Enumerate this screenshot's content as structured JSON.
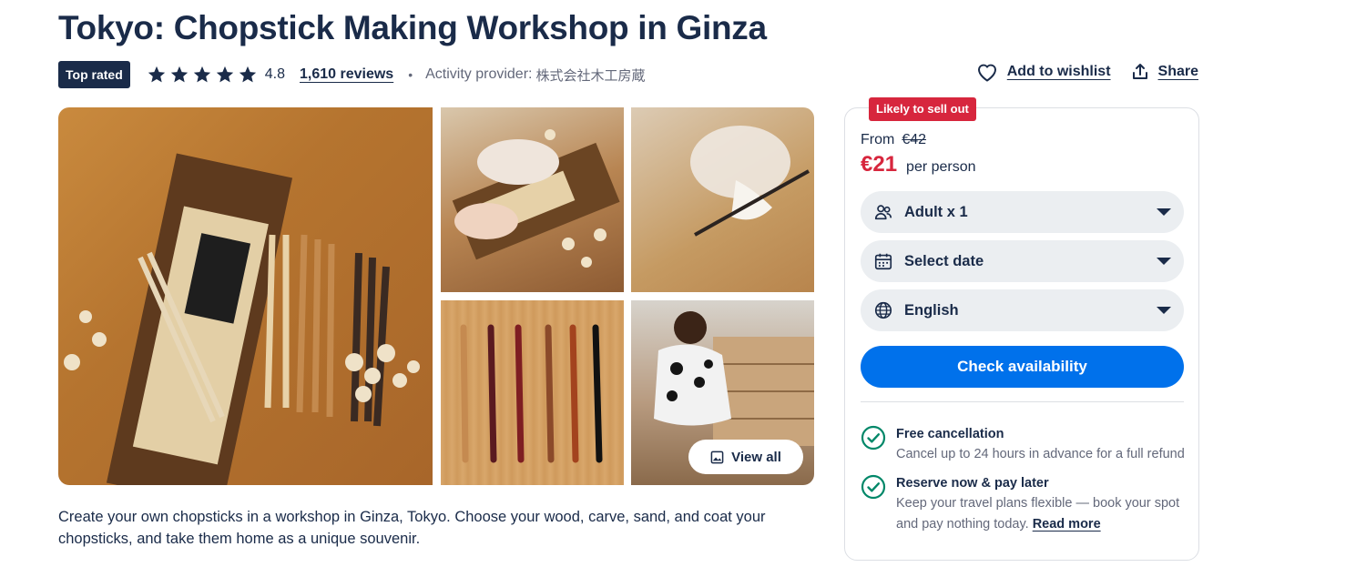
{
  "title": "Tokyo: Chopstick Making Workshop in Ginza",
  "meta": {
    "badge": "Top rated",
    "stars": 5,
    "rating": "4.8",
    "reviews": "1,610 reviews",
    "separator": "•",
    "provider_label": "Activity provider:",
    "provider_name": "株式会社木工房蔵"
  },
  "actions": {
    "wishlist": "Add to wishlist",
    "share": "Share"
  },
  "gallery": {
    "view_all": "View all"
  },
  "description": "Create your own chopsticks in a workshop in Ginza, Tokyo. Choose your wood, carve, sand, and coat your chopsticks, and take them home as a unique souvenir.",
  "booking": {
    "badge": "Likely to sell out",
    "from_label": "From",
    "old_price": "€42",
    "price": "€21",
    "per_person": "per person",
    "participants": "Adult x 1",
    "date": "Select date",
    "language": "English",
    "check_button": "Check availability",
    "benefits": [
      {
        "title": "Free cancellation",
        "desc": "Cancel up to 24 hours in advance for a full refund"
      },
      {
        "title": "Reserve now & pay later",
        "desc": "Keep your travel plans flexible — book your spot and pay nothing today.",
        "link": "Read more"
      }
    ]
  },
  "colors": {
    "navy": "#1a2b49",
    "brand_blue": "#0071eb",
    "alert_red": "#d7263d",
    "check_green": "#008768"
  }
}
